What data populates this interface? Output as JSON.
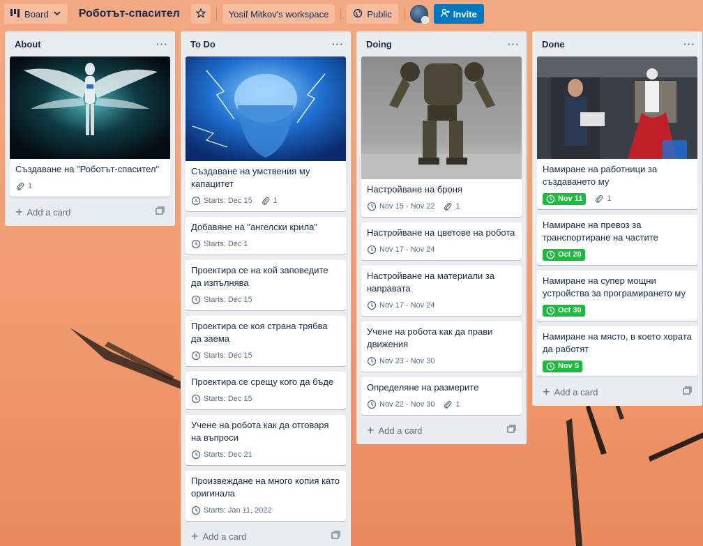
{
  "header": {
    "board_view_label": "Board",
    "title": "Роботът-спасител",
    "workspace_label": "Yosif Mitkov's workspace",
    "visibility_label": "Public",
    "invite_label": "Invite"
  },
  "lists": [
    {
      "title": "About",
      "add_label": "Add a card",
      "cards": [
        {
          "title": "Създаване на \"Роботът-спасител\"",
          "attachments": "1"
        }
      ]
    },
    {
      "title": "To Do",
      "add_label": "Add a card",
      "cards": [
        {
          "title": "Създаване на умствения му капацитет",
          "date": "Starts: Dec 15",
          "attachments": "1"
        },
        {
          "title": "Добавяне на \"ангелски крила\"",
          "date": "Starts: Dec 1"
        },
        {
          "title": "Проектира се на кой заповедите да изпълнява",
          "date": "Starts: Dec 15"
        },
        {
          "title": "Проектира се коя страна трябва да заема",
          "date": "Starts: Dec 15"
        },
        {
          "title": "Проектира се срещу кого да бъде",
          "date": "Starts: Dec 15"
        },
        {
          "title": "Учене на робота как да отговаря на въпроси",
          "date": "Starts: Dec 21"
        },
        {
          "title": "Произвеждане на много копия като оригинала",
          "date": "Starts: Jan 11, 2022"
        }
      ]
    },
    {
      "title": "Doing",
      "add_label": "Add a card",
      "cards": [
        {
          "title": "Настройване на броня",
          "date": "Nov 15 - Nov 22",
          "attachments": "1"
        },
        {
          "title": "Настройване на цветове на робота",
          "date": "Nov 17 - Nov 24"
        },
        {
          "title": "Настройване на материали за направата",
          "date": "Nov 17 - Nov 24"
        },
        {
          "title": "Учене на робота как да прави движения",
          "date": "Nov 23 - Nov 30"
        },
        {
          "title": "Определяне на размерите",
          "date": "Nov 22 - Nov 30",
          "attachments": "1"
        }
      ]
    },
    {
      "title": "Done",
      "add_label": "Add a card",
      "cards": [
        {
          "title": "Намиране на работници за създаването му",
          "due": "Nov 11",
          "attachments": "1"
        },
        {
          "title": "Намиране на превоз за транспортиране на частите",
          "due": "Oct 20"
        },
        {
          "title": "Намиране на супер мощни устройства за програмирането му",
          "due": "Oct 30"
        },
        {
          "title": "Намиране на място, в което хората да работят",
          "due": "Nov 5"
        }
      ]
    }
  ],
  "colors": {
    "list_bg": "#ebecf0",
    "due_complete": "#1bbc3e",
    "invite": "#0079bf"
  }
}
